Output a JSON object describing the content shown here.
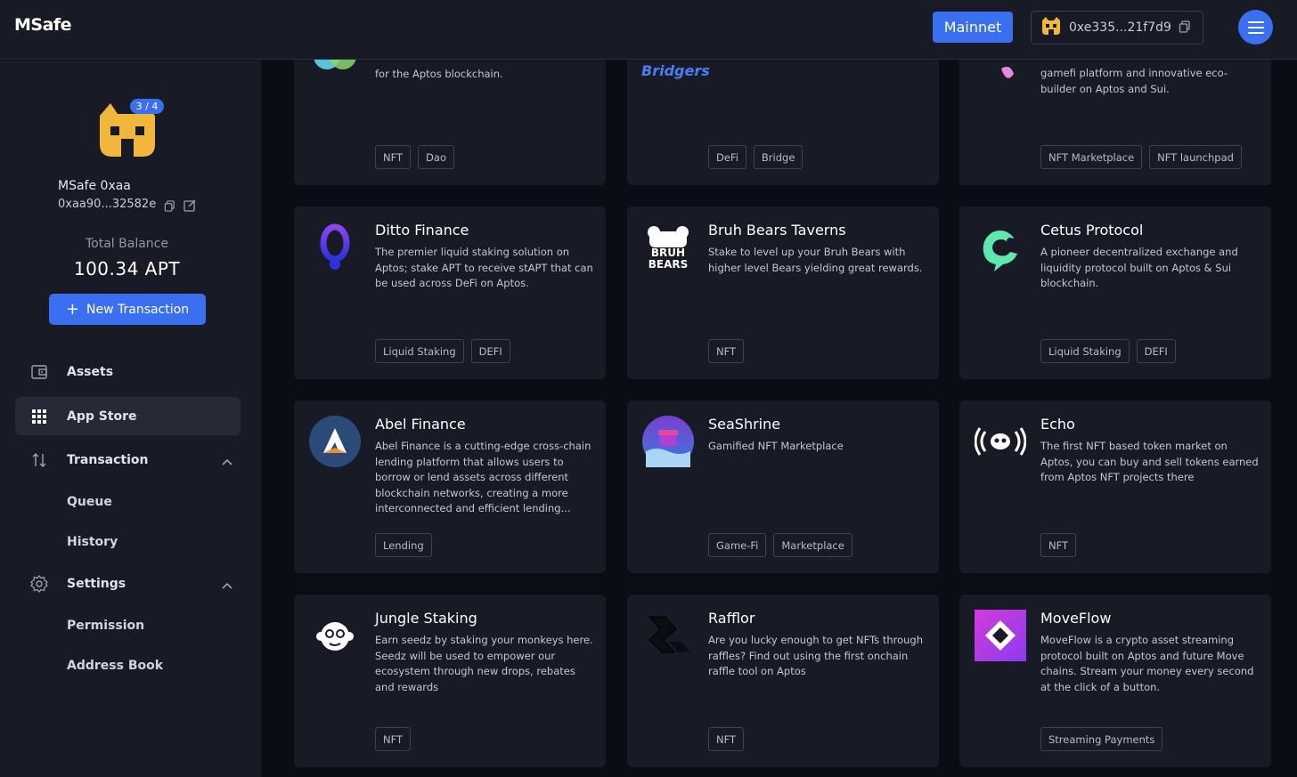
{
  "topbar": {
    "logo": "MSafe",
    "network_label": "Mainnet",
    "wallet_address": "0xe335...21f7d9",
    "icons": [
      "wallet-avatar-icon",
      "copy-icon",
      "hamburger-menu-icon"
    ]
  },
  "sidebar": {
    "signers_badge": "3 / 4",
    "account_name": "MSafe 0xaa",
    "account_address": "0xaa90...32582e",
    "total_balance_label": "Total Balance",
    "total_balance_value": "100.34 APT",
    "new_transaction_label": "New Transaction",
    "nav": {
      "assets": "Assets",
      "app_store": "App Store",
      "transaction": "Transaction",
      "queue": "Queue",
      "history": "History",
      "settings": "Settings",
      "permission": "Permission",
      "address_book": "Address Book"
    }
  },
  "apps": [
    {
      "name": "",
      "description": "for the Aptos blockchain.",
      "tags": [
        "NFT",
        "Dao"
      ]
    },
    {
      "name": "",
      "logo_text": "Bridgers",
      "description": "",
      "tags": [
        "DeFi",
        "Bridge"
      ]
    },
    {
      "name": "",
      "description": "gamefi platform and innovative eco-builder on Aptos and Sui.",
      "tags": [
        "NFT Marketplace",
        "NFT launchpad"
      ]
    },
    {
      "name": "Ditto Finance",
      "description": "The premier liquid staking solution on Aptos; stake APT to receive stAPT that can be used across DeFi on Aptos.",
      "tags": [
        "Liquid Staking",
        "DEFI"
      ]
    },
    {
      "name": "Bruh Bears Taverns",
      "logo_text": "BRUH BEARS",
      "description": "Stake to level up your Bruh Bears with higher level Bears yielding great rewards.",
      "tags": [
        "NFT"
      ]
    },
    {
      "name": "Cetus Protocol",
      "description": "A pioneer decentralized exchange and liquidity protocol built on Aptos & Sui blockchain.",
      "tags": [
        "Liquid Staking",
        "DEFI"
      ]
    },
    {
      "name": "Abel Finance",
      "description": "Abel Finance is a cutting-edge cross-chain lending platform that allows users to borrow or lend assets across different blockchain networks, creating a more interconnected and efficient lending...",
      "tags": [
        "Lending"
      ]
    },
    {
      "name": "SeaShrine",
      "description": "Gamified NFT Marketplace",
      "tags": [
        "Game-Fi",
        "Marketplace"
      ]
    },
    {
      "name": "Echo",
      "description": "The first NFT based token market on Aptos, you can buy and sell tokens earned from Aptos NFT projects there",
      "tags": [
        "NFT"
      ]
    },
    {
      "name": "Jungle Staking",
      "description": "Earn seedz by staking your monkeys here. Seedz will be used to empower our ecosystem through new drops, rebates and rewards",
      "tags": [
        "NFT"
      ]
    },
    {
      "name": "Rafflor",
      "description": "Are you lucky enough to get NFTs through raffles? Find out using the first onchain raffle tool on Aptos",
      "tags": [
        "NFT"
      ]
    },
    {
      "name": "MoveFlow",
      "description": "MoveFlow is a crypto asset streaming protocol built on Aptos and future Move chains. Stream your money every second at the click of a button.",
      "tags": [
        "Streaming Payments"
      ]
    }
  ],
  "colors": {
    "accent": "#3a6ff0",
    "panel": "#181b26",
    "background": "#0b0d14"
  }
}
